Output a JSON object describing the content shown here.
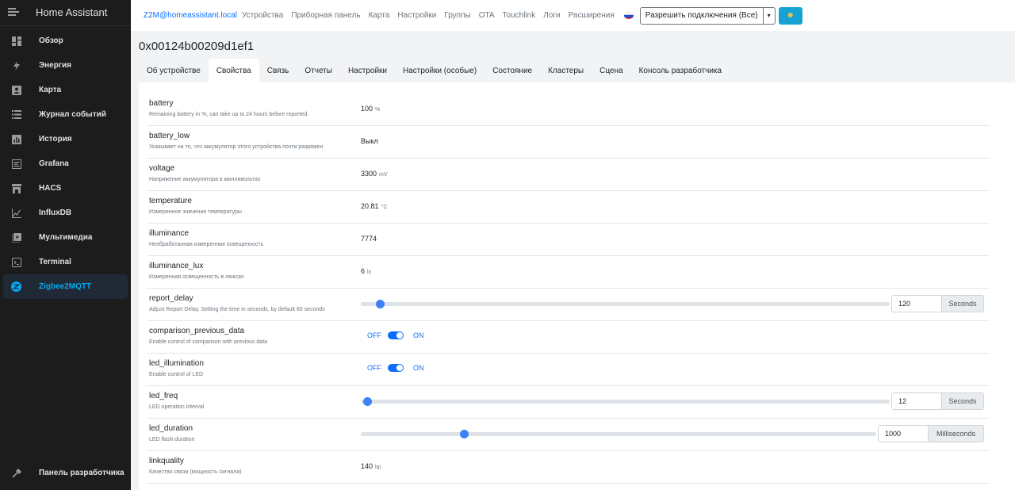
{
  "app_title": "Home Assistant",
  "sidebar": {
    "items": [
      {
        "label": "Обзор",
        "icon": "view-dashboard-icon"
      },
      {
        "label": "Энергия",
        "icon": "lightning-bolt-icon"
      },
      {
        "label": "Карта",
        "icon": "account-box-icon"
      },
      {
        "label": "Журнал событий",
        "icon": "format-list-icon"
      },
      {
        "label": "История",
        "icon": "chart-box-icon"
      },
      {
        "label": "Grafana",
        "icon": "grafana-icon"
      },
      {
        "label": "HACS",
        "icon": "store-icon"
      },
      {
        "label": "InfluxDB",
        "icon": "chart-areaspline-icon"
      },
      {
        "label": "Мультимедиа",
        "icon": "play-box-icon"
      },
      {
        "label": "Terminal",
        "icon": "console-icon"
      },
      {
        "label": "Zigbee2MQTT",
        "icon": "zigbee-icon",
        "active": true
      }
    ],
    "dev_tools": "Панель разработчика"
  },
  "topnav": {
    "brand": "Z2M@homeassistant.local",
    "links": [
      "Устройства",
      "Приборная панель",
      "Карта",
      "Настройки",
      "Группы",
      "OTA",
      "Touchlink",
      "Логи",
      "Расширения"
    ],
    "permit_join": "Разрешить подключения (Все)"
  },
  "device": {
    "title": "0x00124b00209d1ef1",
    "tabs": [
      "Об устройстве",
      "Свойства",
      "Связь",
      "Отчеты",
      "Настройки",
      "Настройки (особые)",
      "Состояние",
      "Кластеры",
      "Сцена",
      "Консоль разработчика"
    ],
    "active_tab": 1
  },
  "properties": {
    "battery": {
      "name": "battery",
      "desc": "Remaining battery in %, can take up to 24 hours before reported.",
      "value": "100",
      "unit": "%"
    },
    "battery_low": {
      "name": "battery_low",
      "desc": "Указывает на то, что аккумулятор этого устройства почти разряжен",
      "value": "Выкл"
    },
    "voltage": {
      "name": "voltage",
      "desc": "Напряжение аккумулятора в милливольтах",
      "value": "3300",
      "unit": "mV"
    },
    "temperature": {
      "name": "temperature",
      "desc": "Измеренное значение температуры",
      "value": "20.81",
      "unit": "°C"
    },
    "illuminance": {
      "name": "illuminance",
      "desc": "Необработанная измеренная освещенность",
      "value": "7774"
    },
    "illuminance_lux": {
      "name": "illuminance_lux",
      "desc": "Измеренная освещенность в люксах",
      "value": "6",
      "unit": "lx"
    },
    "report_delay": {
      "name": "report_delay",
      "desc": "Adjust Report Delay. Setting the time in seconds, by default 60 seconds",
      "value": "120",
      "unit": "Seconds",
      "level": 0.036
    },
    "comparison_previous_data": {
      "name": "comparison_previous_data",
      "desc": "Enable control of comparison with previous data",
      "off": "OFF",
      "on": "ON",
      "state": true
    },
    "led_illumination": {
      "name": "led_illumination",
      "desc": "Enable control of LED",
      "off": "OFF",
      "on": "ON",
      "state": true
    },
    "led_freq": {
      "name": "led_freq",
      "desc": "LED operation interval",
      "value": "12",
      "unit": "Seconds",
      "level": 0.012
    },
    "led_duration": {
      "name": "led_duration",
      "desc": "LED flash duration",
      "value": "1000",
      "unit": "Milliseconds",
      "level": 0.2
    },
    "linkquality": {
      "name": "linkquality",
      "desc": "Качество связи (мощность сигнала)",
      "value": "140",
      "unit": "lqi"
    }
  },
  "colors": {
    "accent": "#03a9f4",
    "primary": "#0d6efd",
    "sidebar_bg": "#1c1c1c",
    "slider_thumb": "#3b82f6"
  }
}
